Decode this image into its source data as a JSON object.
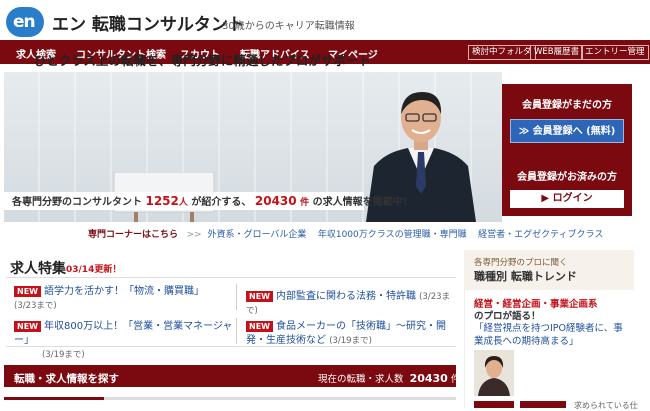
{
  "header": {
    "logo_mark": "en",
    "logo_text": "エン 転職コンサルタント",
    "tagline": "30歳からのキャリア転職情報"
  },
  "nav": {
    "items": [
      "求人検索",
      "コンサルタント検索",
      "スカウト",
      "転職アドバイス",
      "マイページ"
    ],
    "buttons": [
      "検討中フォルダ",
      "WEB履歴書",
      "エントリー管理"
    ]
  },
  "hero": {
    "headline": "ひとクラス上の転職を、専門分野に精通したプロがサポート",
    "stats_prefix": "各専門分野のコンサルタント",
    "consultant_count": "1252",
    "consultant_unit": "人",
    "stats_middle": "が紹介する、",
    "job_count": "20430",
    "job_unit": "件",
    "stats_suffix": "の求人情報を掲載中！"
  },
  "register": {
    "not_registered": "会員登録がまだの方",
    "register_button": "≫ 会員登録へ (無料)",
    "registered": "会員登録がお済みの方",
    "login_button": "▶ ログイン"
  },
  "corner": {
    "label": "専門コーナーはこちら",
    "links": [
      "外資系・グローバル企業",
      "年収1000万クラスの管理職・専門職",
      "経営者・エグゼクティブクラス"
    ]
  },
  "feature": {
    "title": "求人特集",
    "updated": "03/14更新！",
    "new_badge": "NEW",
    "items": [
      {
        "text": "語学力を活かす！「物流・購買職」",
        "date": "(3/23まで)"
      },
      {
        "text": "内部監査に関わる法務・特許職",
        "date": "(3/23まで)"
      },
      {
        "text": "年収800万以上！「営業・営業マネージャー」",
        "date": "(3/19まで)"
      },
      {
        "text": "食品メーカーの「技術職」～研究・開発・生産技術など",
        "date": "(3/19まで)"
      }
    ]
  },
  "search": {
    "title": "転職・求人情報を探す",
    "count_label": "現在の転職・求人数",
    "count": "20430",
    "count_unit": "件"
  },
  "side": {
    "small": "各専門分野のプロに聞く",
    "title": "職種別 転職トレンド",
    "category1": "経営・経営企画・事業企画系",
    "category2": "のプロが語る！",
    "quote": "「経営視点を持つIPO経験者に、事業成長への期待高まる」",
    "bottom_text": "求められている仕"
  },
  "colors": {
    "brand": "#7b0a10",
    "accent_red": "#c4121a",
    "link_blue": "#1f4e9c",
    "logo_blue": "#2a7dc8"
  }
}
